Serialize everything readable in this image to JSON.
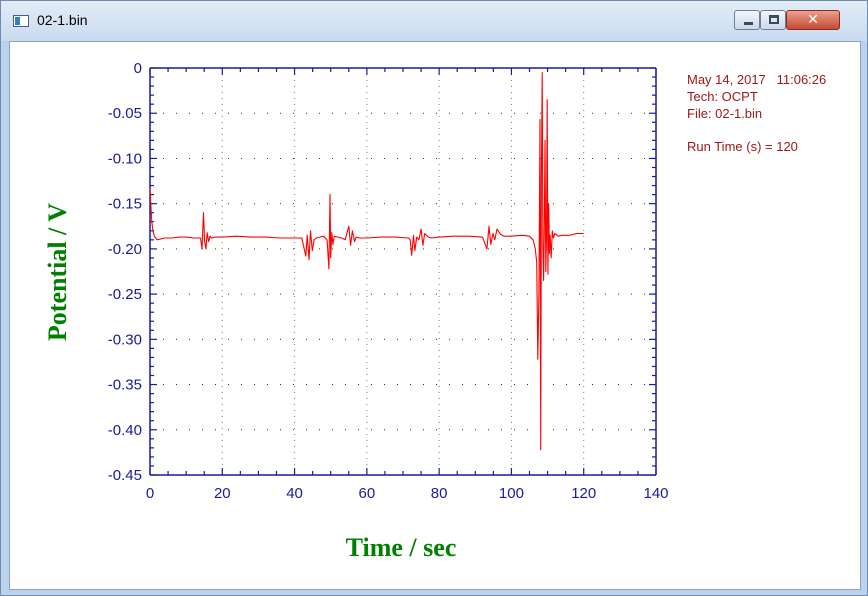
{
  "window": {
    "title": "02-1.bin",
    "close_glyph": "✕"
  },
  "info": {
    "date_time": "May 14, 2017   11:06:26",
    "tech": "Tech: OCPT",
    "file": "File: 02-1.bin",
    "run_time": "Run Time (s) = 120"
  },
  "chart_data": {
    "type": "line",
    "xlabel": "Time / sec",
    "ylabel": "Potential / V",
    "xlim": [
      0,
      140
    ],
    "ylim": [
      -0.45,
      0
    ],
    "x_ticks": [
      0,
      20,
      40,
      60,
      80,
      100,
      120,
      140
    ],
    "x_tick_labels": [
      "0",
      "20",
      "40",
      "60",
      "80",
      "100",
      "120",
      "140"
    ],
    "y_ticks": [
      0,
      -0.05,
      -0.1,
      -0.15,
      -0.2,
      -0.25,
      -0.3,
      -0.35,
      -0.4,
      -0.45
    ],
    "y_tick_labels": [
      "0",
      "-0.05",
      "-0.10",
      "-0.15",
      "-0.20",
      "-0.25",
      "-0.30",
      "-0.35",
      "-0.40",
      "-0.45"
    ],
    "grid": "dotted",
    "colors": {
      "axis": "#1a1a9c",
      "grid": "#8a7a3a",
      "line": "#ff0000",
      "label": "#008000"
    },
    "series": [
      {
        "x": [
          0,
          0.2,
          0.5,
          0.8,
          1.2,
          2,
          4,
          6,
          8,
          10,
          12,
          14,
          14.4,
          14.8,
          15.1,
          15.5,
          15.8,
          16.2,
          16.6,
          17,
          18,
          20,
          24,
          28,
          32,
          36,
          40,
          42,
          43.1,
          43.5,
          44,
          44.4,
          44.9,
          45.4,
          46,
          47,
          48,
          49,
          49.5,
          49.8,
          50,
          50.3,
          50.6,
          51,
          52,
          53,
          54,
          55,
          55.5,
          56,
          56.6,
          57,
          58,
          60,
          64,
          68,
          71.5,
          72,
          72.4,
          72.9,
          73.3,
          73.8,
          74.4,
          75,
          75.5,
          76,
          77,
          78,
          80,
          84,
          88,
          92,
          93.2,
          93.8,
          94.3,
          94.9,
          95.4,
          96,
          97,
          98,
          100,
          103,
          105,
          106,
          106.6,
          107.0,
          107.3,
          107.6,
          107.9,
          108.1,
          108.3,
          108.5,
          108.7,
          108.9,
          109.1,
          109.3,
          109.5,
          109.7,
          109.9,
          110.1,
          110.3,
          110.5,
          110.7,
          111.0,
          111.3,
          111.6,
          112,
          113,
          114,
          116,
          118,
          120
        ],
        "y": [
          -0.133,
          -0.148,
          -0.17,
          -0.18,
          -0.186,
          -0.19,
          -0.188,
          -0.188,
          -0.187,
          -0.187,
          -0.188,
          -0.188,
          -0.2,
          -0.16,
          -0.192,
          -0.2,
          -0.182,
          -0.192,
          -0.186,
          -0.188,
          -0.187,
          -0.187,
          -0.186,
          -0.187,
          -0.187,
          -0.188,
          -0.188,
          -0.188,
          -0.208,
          -0.185,
          -0.212,
          -0.18,
          -0.202,
          -0.19,
          -0.188,
          -0.187,
          -0.186,
          -0.19,
          -0.222,
          -0.14,
          -0.21,
          -0.182,
          -0.195,
          -0.186,
          -0.187,
          -0.188,
          -0.19,
          -0.175,
          -0.196,
          -0.18,
          -0.192,
          -0.187,
          -0.188,
          -0.188,
          -0.187,
          -0.187,
          -0.188,
          -0.19,
          -0.207,
          -0.185,
          -0.202,
          -0.187,
          -0.19,
          -0.178,
          -0.196,
          -0.183,
          -0.187,
          -0.188,
          -0.187,
          -0.186,
          -0.186,
          -0.187,
          -0.2,
          -0.175,
          -0.195,
          -0.183,
          -0.19,
          -0.178,
          -0.184,
          -0.186,
          -0.186,
          -0.185,
          -0.186,
          -0.19,
          -0.2,
          -0.215,
          -0.322,
          -0.25,
          -0.057,
          -0.422,
          -0.12,
          -0.005,
          -0.2,
          -0.235,
          -0.175,
          -0.08,
          -0.225,
          -0.188,
          -0.035,
          -0.228,
          -0.15,
          -0.205,
          -0.185,
          -0.21,
          -0.18,
          -0.188,
          -0.183,
          -0.186,
          -0.185,
          -0.185,
          -0.183,
          -0.183
        ]
      }
    ]
  }
}
